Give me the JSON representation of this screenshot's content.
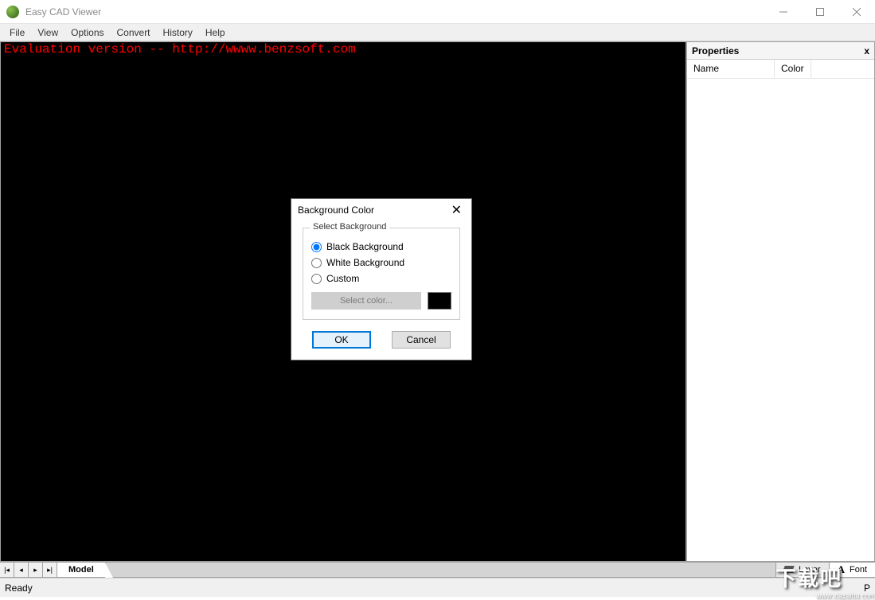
{
  "app": {
    "title": "Easy CAD Viewer"
  },
  "menus": {
    "file": "File",
    "view": "View",
    "options": "Options",
    "convert": "Convert",
    "history": "History",
    "help": "Help"
  },
  "viewport": {
    "eval_notice": "Evaluation version -- http://wwww.benzsoft.com"
  },
  "properties": {
    "title": "Properties",
    "col_name": "Name",
    "col_color": "Color"
  },
  "tabs": {
    "model": "Model",
    "layer": "Layer",
    "font": "Font"
  },
  "status": {
    "ready": "Ready",
    "p": "P"
  },
  "dialog": {
    "title": "Background Color",
    "group_caption": "Select Background",
    "opt_black": "Black Background",
    "opt_white": "White Background",
    "opt_custom": "Custom",
    "select_color": "Select color...",
    "swatch_color": "#000000",
    "ok": "OK",
    "cancel": "Cancel",
    "selected": "black"
  },
  "watermark": {
    "text": "下载吧",
    "url": "www.xiazaiba.com"
  }
}
